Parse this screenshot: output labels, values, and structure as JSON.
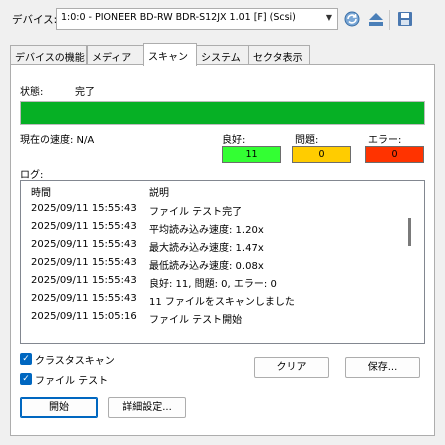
{
  "device": {
    "label": "デバイス:",
    "selected": "1:0:0 - PIONEER BD-RW  BDR-S12JX 1.01 [F] (Scsi)"
  },
  "toolbar": {
    "icons": [
      "refresh-icon",
      "eject-icon",
      "save-icon"
    ]
  },
  "tabs": [
    {
      "label": "デバイスの機能",
      "active": false
    },
    {
      "label": "メディア",
      "active": false
    },
    {
      "label": "スキャン",
      "active": true
    },
    {
      "label": "システム",
      "active": false
    },
    {
      "label": "セクタ表示",
      "active": false
    }
  ],
  "scan": {
    "status_label": "状態:",
    "status_value": "完了",
    "progress_percent": 100,
    "speed": "現在の速度: N/A",
    "good_label": "良好:",
    "good_value": "11",
    "issue_label": "問題:",
    "issue_value": "0",
    "error_label": "エラー:",
    "error_value": "0",
    "colors": {
      "good": "#33ff33",
      "issue": "#ffcc00",
      "error": "#ff3300",
      "progress": "#06b025"
    }
  },
  "log": {
    "label": "ログ:",
    "columns": [
      "時間",
      "説明"
    ],
    "rows": [
      {
        "time": "2025/09/11 15:55:43",
        "desc": "ファイル テスト完了"
      },
      {
        "time": "2025/09/11 15:55:43",
        "desc": "平均読み込み速度: 1.20x"
      },
      {
        "time": "2025/09/11 15:55:43",
        "desc": "最大読み込み速度: 1.47x"
      },
      {
        "time": "2025/09/11 15:55:43",
        "desc": "最低読み込み速度: 0.08x"
      },
      {
        "time": "2025/09/11 15:55:43",
        "desc": "良好: 11, 問題: 0, エラー: 0"
      },
      {
        "time": "2025/09/11 15:55:43",
        "desc": "11 ファイルをスキャンしました"
      },
      {
        "time": "2025/09/11 15:05:16",
        "desc": "ファイル テスト開始"
      }
    ]
  },
  "options": {
    "cluster_scan": "クラスタスキャン",
    "file_test": "ファイル テスト"
  },
  "buttons": {
    "clear": "クリア",
    "save": "保存...",
    "start": "開始",
    "advanced": "詳細設定..."
  }
}
